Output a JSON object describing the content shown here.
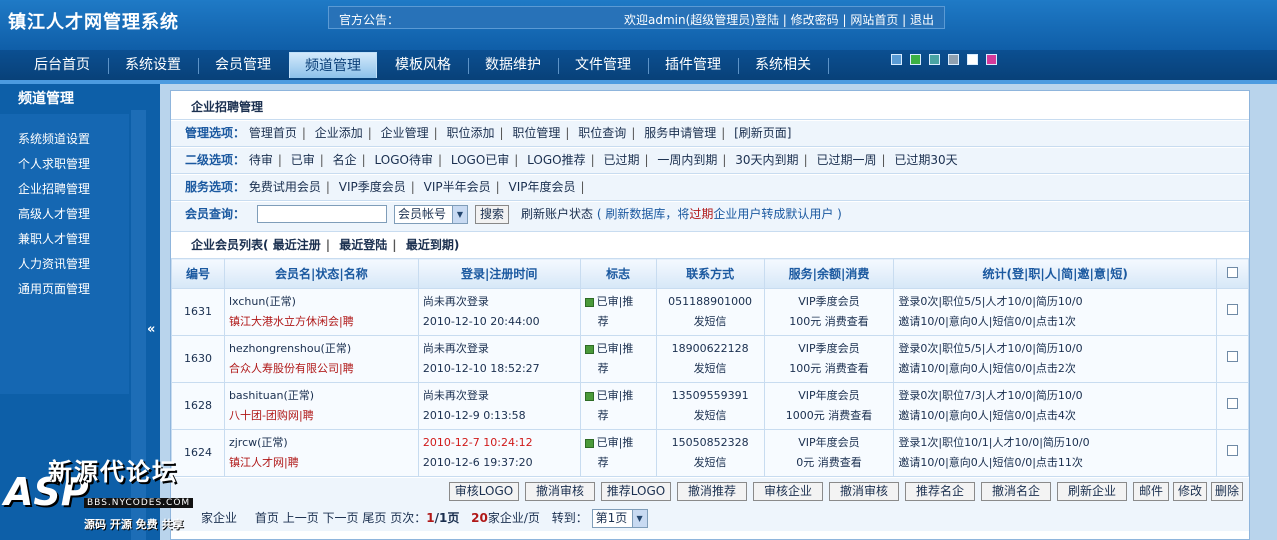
{
  "app_title": "镇江人才网管理系统",
  "notice_label": "官方公告：",
  "welcome": "欢迎admin(超级管理员)登陆 | 修改密码 | 网站首页 | 退出",
  "nav": [
    "后台首页",
    "系统设置",
    "会员管理",
    "频道管理",
    "模板风格",
    "数据维护",
    "文件管理",
    "插件管理",
    "系统相关"
  ],
  "nav_active": "频道管理",
  "theme_colors": [
    "#5a9bd4",
    "#3cb043",
    "#4aa3a3",
    "#8fa0b0",
    "#ffffff",
    "#d33a9a"
  ],
  "sidebar": {
    "title": "频道管理",
    "items": [
      "系统频道设置",
      "个人求职管理",
      "企业招聘管理",
      "高级人才管理",
      "兼职人才管理",
      "人力资讯管理",
      "通用页面管理"
    ],
    "collapse": "«"
  },
  "panel_title": "企业招聘管理",
  "rows": {
    "manage": {
      "label": "管理选项：",
      "items": [
        "管理首页",
        "企业添加",
        "企业管理",
        "职位添加",
        "职位管理",
        "职位查询",
        "服务申请管理",
        "[刷新页面]"
      ]
    },
    "level2": {
      "label": "二级选项：",
      "items": [
        "待审",
        "已审",
        "名企",
        "LOGO待审",
        "LOGO已审",
        "LOGO推荐",
        "已过期",
        "一周内到期",
        "30天内到期",
        "已过期一周",
        "已过期30天"
      ]
    },
    "service": {
      "label": "服务选项：",
      "items": [
        "免费试用会员",
        "VIP季度会员",
        "VIP半年会员",
        "VIP年度会员"
      ]
    }
  },
  "search": {
    "label": "会员查询：",
    "value": "",
    "select": "会员帐号",
    "button": "搜索",
    "refresh_a": "刷新账户状态",
    "refresh_b": "( 刷新数据库，将",
    "refresh_c": "过期",
    "refresh_d": "企业用户转成默认用户 )"
  },
  "list_title": "企业会员列表(",
  "list_links": [
    "最近注册",
    "最近登陆",
    "最近到期"
  ],
  "list_end": ")",
  "columns": [
    "编号",
    "会员名|状态|名称",
    "登录|注册时间",
    "标志",
    "联系方式",
    "服务|余额|消费",
    "统计(登|职|人|简|邀|意|短)"
  ],
  "members": [
    {
      "id": "1631",
      "user": "lxchun",
      "status": "(正常)",
      "company": "镇江大港水立方休闲会",
      "tag": "|聘",
      "login": "尚未再次登录",
      "reg": "2010-12-10 20:44:00",
      "flag1": "已审",
      "flag2": "|推",
      "flag3": "荐",
      "phone": "051188901000",
      "sms": "发短信",
      "service": "VIP季度会员",
      "balance": "100元",
      "consume": "消费查看",
      "stat1": "登录0次|职位5/5|人才10/0|简历10/0",
      "stat2": "邀请10/0|意向0人|短信0/0|点击1次",
      "login_red": false
    },
    {
      "id": "1630",
      "user": "hezhongrenshou",
      "status": "(正常)",
      "company": "合众人寿股份有限公司",
      "tag": "|聘",
      "login": "尚未再次登录",
      "reg": "2010-12-10 18:52:27",
      "flag1": "已审",
      "flag2": "|推",
      "flag3": "荐",
      "phone": "18900622128",
      "sms": "发短信",
      "service": "VIP季度会员",
      "balance": "100元",
      "consume": "消费查看",
      "stat1": "登录0次|职位5/5|人才10/0|简历10/0",
      "stat2": "邀请10/0|意向0人|短信0/0|点击2次",
      "login_red": false
    },
    {
      "id": "1628",
      "user": "bashituan",
      "status": "(正常)",
      "company": "八十团-团购网",
      "tag": "|聘",
      "login": "尚未再次登录",
      "reg": "2010-12-9 0:13:58",
      "flag1": "已审",
      "flag2": "|推",
      "flag3": "荐",
      "phone": "13509559391",
      "sms": "发短信",
      "service": "VIP年度会员",
      "balance": "1000元",
      "consume": "消费查看",
      "stat1": "登录0次|职位7/3|人才10/0|简历10/0",
      "stat2": "邀请10/0|意向0人|短信0/0|点击4次",
      "login_red": false
    },
    {
      "id": "1624",
      "user": "zjrcw",
      "status": "(正常)",
      "company": "镇江人才网",
      "tag": "|聘",
      "login": "2010-12-7 10:24:12",
      "reg": "2010-12-6 19:37:20",
      "flag1": "已审",
      "flag2": "|推",
      "flag3": "荐",
      "phone": "15050852328",
      "sms": "发短信",
      "service": "VIP年度会员",
      "balance": "0元",
      "consume": "消费查看",
      "stat1": "登录1次|职位10/1|人才10/0|简历10/0",
      "stat2": "邀请10/0|意向0人|短信0/0|点击11次",
      "login_red": true
    }
  ],
  "actions": [
    "审核LOGO",
    "撤消审核",
    "推荐LOGO",
    "撤消推荐",
    "审核企业",
    "撤消审核",
    "推荐名企",
    "撤消名企",
    "刷新企业",
    "邮件",
    "修改",
    "删除"
  ],
  "pager": {
    "total_label": "家企业",
    "links": [
      "首页",
      "上一页",
      "下一页",
      "尾页"
    ],
    "page_label": "页次：",
    "page_current": "1",
    "page_total": "/1页",
    "per_page_num": "20",
    "per_page_label": "家企业/页",
    "goto_label": "转到：",
    "goto_value": "第1页"
  },
  "watermark": {
    "cn": "新源代论坛",
    "logo": "ASP",
    "url": "BBS.NYCODES.COM",
    "sub": "源码 开源 免费 共享"
  }
}
